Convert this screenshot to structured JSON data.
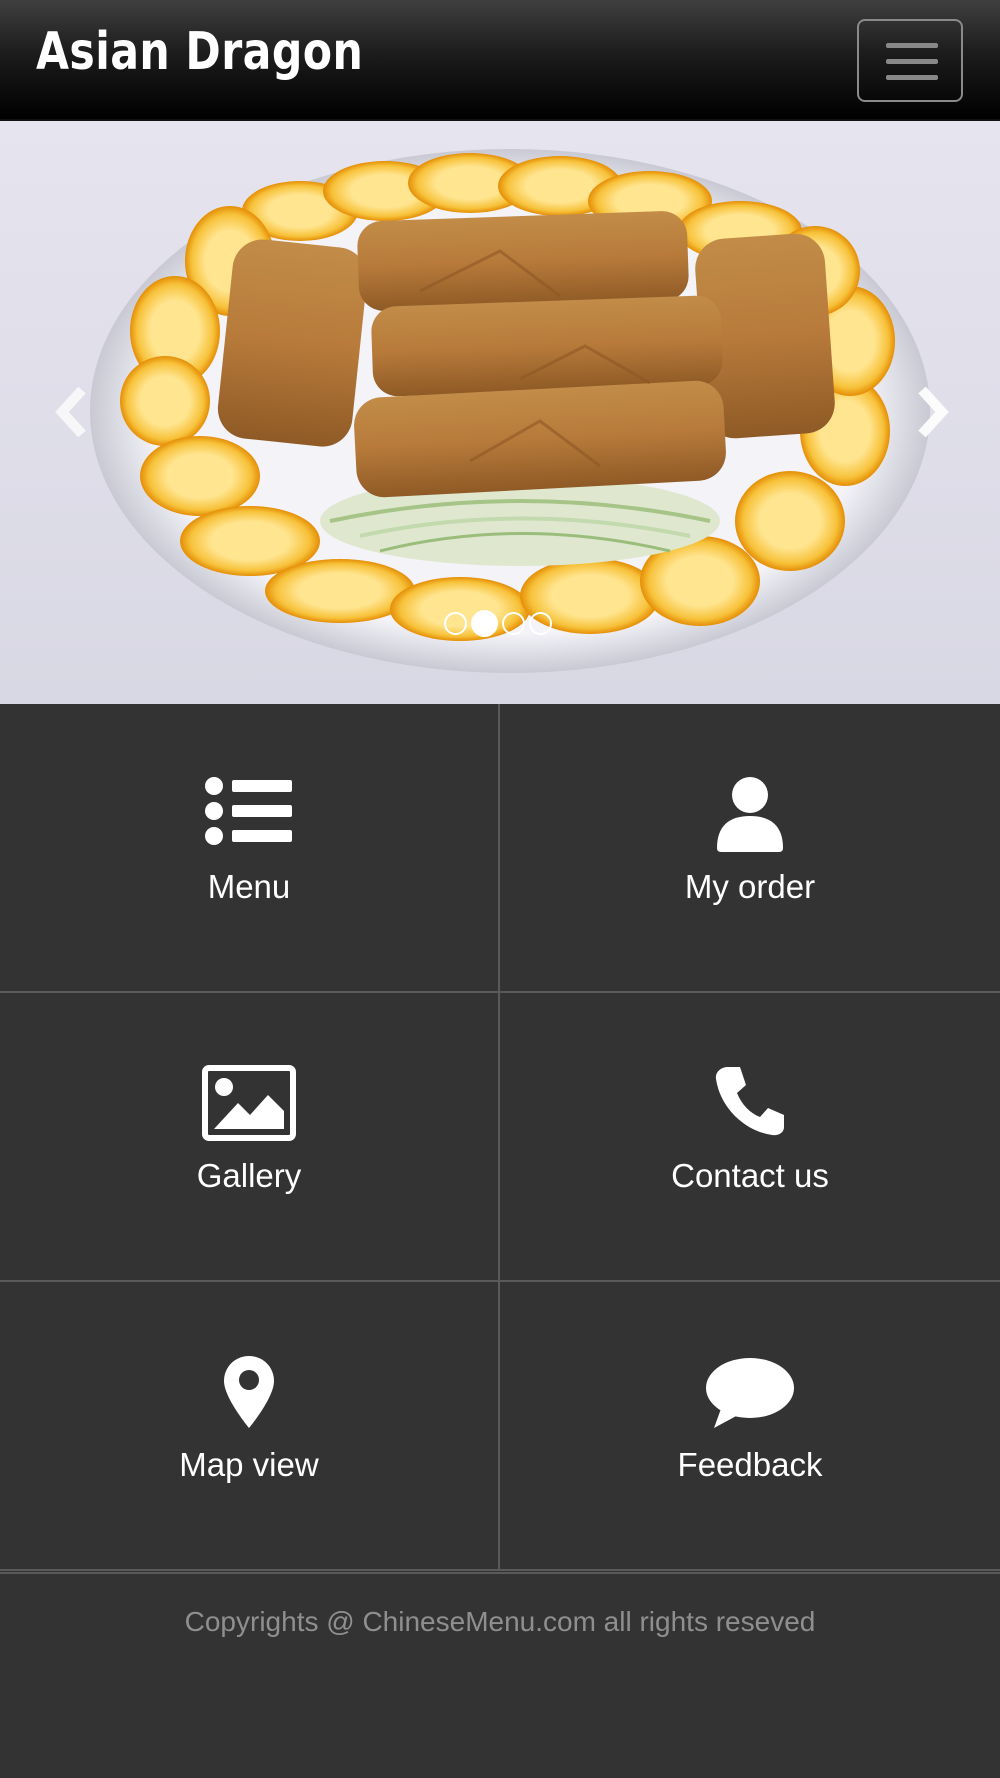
{
  "navbar": {
    "brand": "Asian Dragon",
    "menu_icon": "hamburger-icon"
  },
  "carousel": {
    "slide_count": 4,
    "active_index": 1,
    "prev_icon": "chevron-left-icon",
    "next_icon": "chevron-right-icon"
  },
  "tiles": [
    {
      "label": "Menu",
      "icon": "list-icon"
    },
    {
      "label": "My order",
      "icon": "user-icon"
    },
    {
      "label": "Gallery",
      "icon": "image-icon"
    },
    {
      "label": "Contact us",
      "icon": "phone-icon"
    },
    {
      "label": "Map view",
      "icon": "map-marker-icon"
    },
    {
      "label": "Feedback",
      "icon": "comment-icon"
    }
  ],
  "footer": {
    "copyright": "Copyrights @ ChineseMenu.com all rights reseved"
  },
  "colors": {
    "background": "#333333",
    "navbar": "#000000",
    "text": "#ffffff",
    "footer_text": "#8f8f8f"
  }
}
